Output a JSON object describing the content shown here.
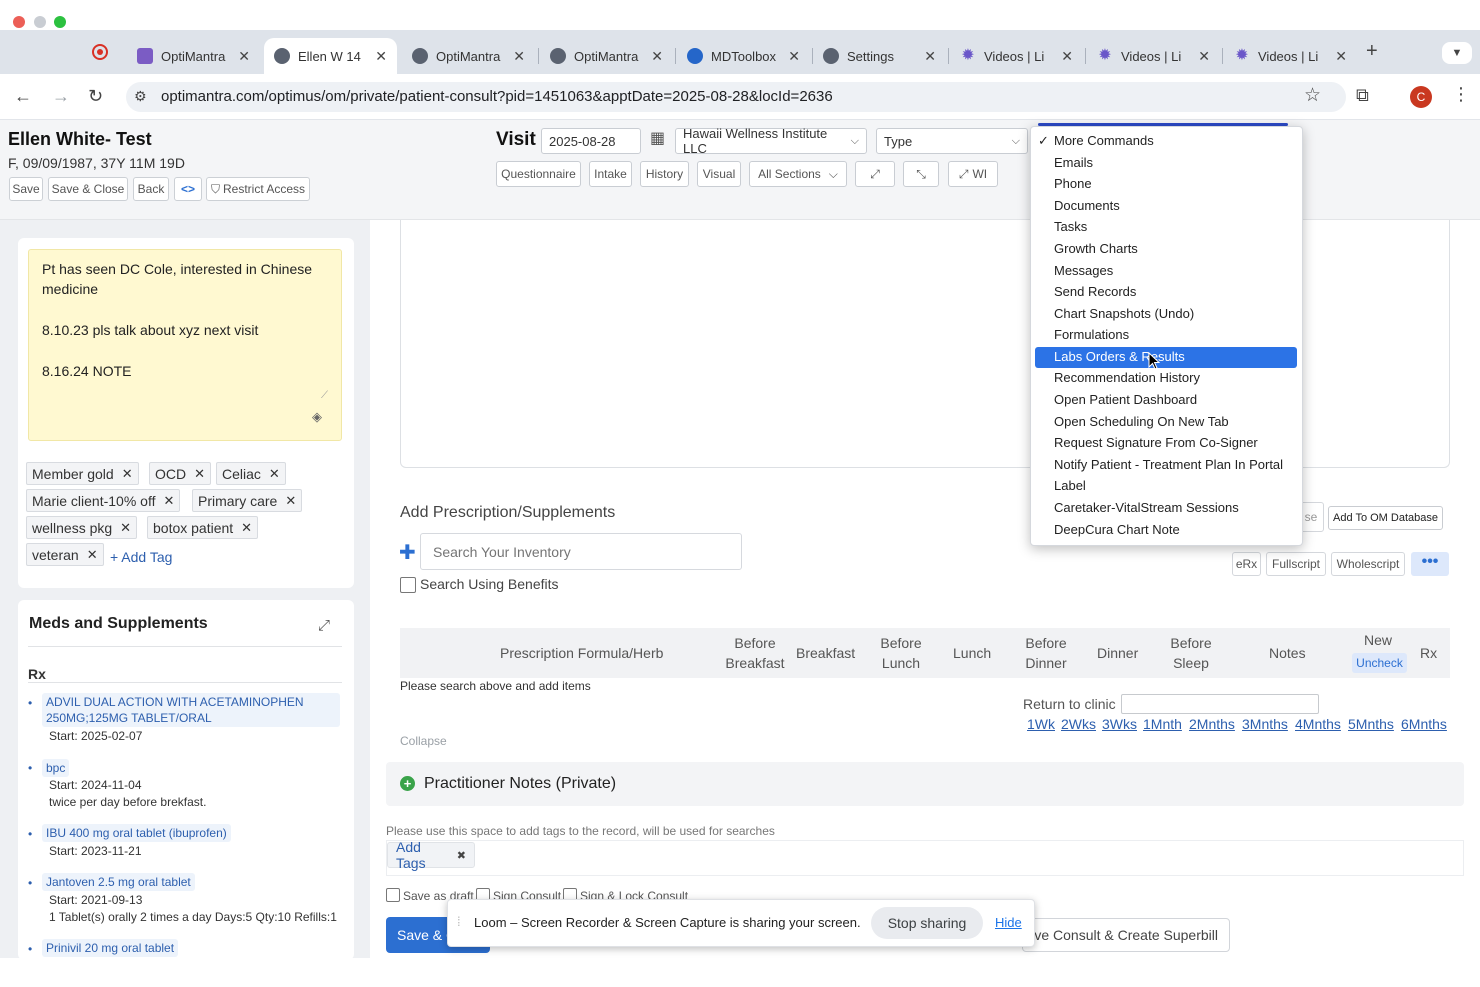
{
  "browser": {
    "tabs": [
      {
        "title": "OptiMantra",
        "icon": "optimantra-logo-icon"
      },
      {
        "title": "Ellen W 14",
        "icon": "optimantra-icon",
        "active": true
      },
      {
        "title": "OptiMantra",
        "icon": "optimantra-icon"
      },
      {
        "title": "OptiMantra",
        "icon": "optimantra-icon"
      },
      {
        "title": "MDToolbox",
        "icon": "mdtoolbox-icon"
      },
      {
        "title": "Settings",
        "icon": "optimantra-icon"
      },
      {
        "title": "Videos | Li",
        "icon": "gear-icon"
      },
      {
        "title": "Videos | Li",
        "icon": "gear-icon"
      },
      {
        "title": "Videos | Li",
        "icon": "gear-icon"
      }
    ],
    "url": "optimantra.com/optimus/om/private/patient-consult?pid=1451063&apptDate=2025-08-28&locId=2636",
    "profile_initial": "C"
  },
  "header": {
    "patient_name": "Ellen White- Test",
    "patient_info": "F, 09/09/1987, 37Y 11M 19D",
    "buttons": {
      "save": "Save",
      "save_close": "Save & Close",
      "back": "Back",
      "restrict": "Restrict Access"
    },
    "visit_label": "Visit",
    "visit_date": "2025-08-28",
    "location": "Hawaii Wellness Institute LLC",
    "type_placeholder": "Type",
    "sections": {
      "questionnaire": "Questionnaire",
      "intake": "Intake",
      "history": "History",
      "visual": "Visual",
      "all_sections": "All Sections",
      "wi": "WI"
    }
  },
  "sidebar": {
    "note_lines": [
      "Pt has seen DC Cole, interested in Chinese medicine",
      "8.10.23 pls talk about xyz next visit",
      "8.16.24 NOTE"
    ],
    "tags": [
      "Member gold",
      "OCD",
      "Celiac",
      "Marie client-10% off",
      "Primary care",
      "wellness pkg",
      "botox patient",
      "veteran"
    ],
    "add_tag": "+ Add Tag",
    "meds_title": "Meds and Supplements",
    "rx_label": "Rx",
    "meds": [
      {
        "name": "ADVIL DUAL ACTION WITH ACETAMINOPHEN 250MG;125MG TABLET/ORAL",
        "lines": [
          "Start: 2025-02-07"
        ]
      },
      {
        "name": "bpc",
        "lines": [
          "Start: 2024-11-04",
          "twice per day before brekfast."
        ]
      },
      {
        "name": "IBU 400 mg oral tablet (ibuprofen)",
        "lines": [
          "Start: 2023-11-21"
        ]
      },
      {
        "name": "Jantoven 2.5 mg oral tablet",
        "lines": [
          "Start: 2021-09-13",
          "1 Tablet(s) orally 2 times a day Days:5 Qty:10 Refills:1"
        ]
      },
      {
        "name": "Prinivil 20 mg oral tablet",
        "lines": []
      }
    ]
  },
  "prescriptions": {
    "title": "Add Prescription/Supplements",
    "search_placeholder": "Search Your Inventory",
    "benefits_label": "Search Using Benefits",
    "use_hint": "se",
    "add_om_db": "Add To OM Database",
    "erx": "eRx",
    "fullscript": "Fullscript",
    "wholescript": "Wholescript",
    "more": "•••",
    "columns": {
      "formula": "Prescription Formula/Herb",
      "before_breakfast": "Before Breakfast",
      "breakfast": "Breakfast",
      "before_lunch": "Before Lunch",
      "lunch": "Lunch",
      "before_dinner": "Before Dinner",
      "dinner": "Dinner",
      "before_sleep": "Before Sleep",
      "notes": "Notes",
      "new": "New",
      "uncheck": "Uncheck",
      "rx": "Rx"
    },
    "empty_message": "Please search above and add items",
    "return_label": "Return to clinic",
    "return_links": [
      "1Wk",
      "2Wks",
      "3Wks",
      "1Mnth",
      "2Mnths",
      "3Mnths",
      "4Mnths",
      "5Mnths",
      "6Mnths"
    ],
    "collapse": "Collapse"
  },
  "notes": {
    "practitioner_title": "Practitioner Notes (Private)",
    "tag_hint": "Please use this space to add tags to the record, will be used for searches",
    "add_tags": "Add Tags",
    "save_draft": "Save as draft",
    "sign_consult": "Sign Consult",
    "sign_lock": "Sign & Lock Consult",
    "save_button": "Save & C",
    "superbill": "ve Consult & Create Superbill"
  },
  "loom": {
    "message": "Loom – Screen Recorder & Screen Capture is sharing your screen.",
    "stop": "Stop sharing",
    "hide": "Hide"
  },
  "menu": {
    "items": [
      "More Commands",
      "Emails",
      "Phone",
      "Documents",
      "Tasks",
      "Growth Charts",
      "Messages",
      "Send Records",
      "Chart Snapshots (Undo)",
      "Formulations",
      "Labs Orders & Results",
      "Recommendation History",
      "Open Patient Dashboard",
      "Open Scheduling On New Tab",
      "Request Signature From Co-Signer",
      "Notify Patient - Treatment Plan In Portal",
      "Label",
      "Caretaker-VitalStream Sessions",
      "DeepCura Chart Note"
    ],
    "checked_index": 0,
    "highlighted_index": 10,
    "highlight_color": "#2c73e6"
  },
  "colors": {
    "accent": "#2c6fd1",
    "link": "#2d5fae",
    "note_bg": "#fff9d1",
    "profile": "#c93820"
  }
}
